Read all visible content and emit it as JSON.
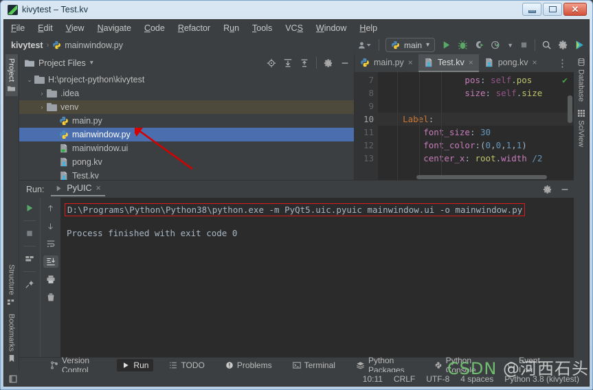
{
  "window": {
    "title": "kivytest – Test.kv",
    "minimize_label": "Minimize",
    "maximize_label": "Restore",
    "close_label": "Close"
  },
  "menubar": [
    {
      "label": "File",
      "mnemonic": "F"
    },
    {
      "label": "Edit",
      "mnemonic": "E"
    },
    {
      "label": "View",
      "mnemonic": "V"
    },
    {
      "label": "Navigate",
      "mnemonic": "N"
    },
    {
      "label": "Code",
      "mnemonic": "C"
    },
    {
      "label": "Refactor",
      "mnemonic": "R"
    },
    {
      "label": "Run",
      "mnemonic": "u"
    },
    {
      "label": "Tools",
      "mnemonic": "T"
    },
    {
      "label": "VCS",
      "mnemonic": "S"
    },
    {
      "label": "Window",
      "mnemonic": "W"
    },
    {
      "label": "Help",
      "mnemonic": "H"
    }
  ],
  "navbar": {
    "breadcrumb_project": "kivytest",
    "breadcrumb_separator": "›",
    "breadcrumb_file": "mainwindow.py",
    "run_config": "main",
    "run_config_dropdown": "▾",
    "icons": [
      "account-dropdown-icon",
      "run-icon",
      "debug-icon",
      "coverage-icon",
      "profile-icon",
      "stop-icon",
      "search-everywhere-icon",
      "settings-icon",
      "ide-help-icon"
    ]
  },
  "left_stripe": [
    {
      "label": "Project",
      "active": true,
      "icon": "folder-icon"
    },
    {
      "label": "Structure",
      "active": false,
      "icon": "structure-icon"
    },
    {
      "label": "Bookmarks",
      "active": false,
      "icon": "bookmark-icon"
    }
  ],
  "right_stripe": [
    {
      "label": "Database",
      "active": false,
      "icon": "database-icon"
    },
    {
      "label": "SciView",
      "active": false,
      "icon": "grid-icon"
    }
  ],
  "project_panel": {
    "title": "Project Files",
    "dropdown": "▾",
    "toolbar_icons": [
      "locate-file-icon",
      "expand-all-icon",
      "collapse-all-icon",
      "settings-icon",
      "hide-panel-icon"
    ],
    "tree": [
      {
        "label": "H:\\project-python\\kivytest",
        "depth": 0,
        "arrow": "⌄",
        "type": "folder",
        "state": "normal"
      },
      {
        "label": ".idea",
        "depth": 1,
        "arrow": "›",
        "type": "folder",
        "state": "normal"
      },
      {
        "label": "venv",
        "depth": 1,
        "arrow": "›",
        "type": "folder",
        "state": "highlight"
      },
      {
        "label": "main.py",
        "depth": 2,
        "arrow": "",
        "type": "python",
        "state": "normal"
      },
      {
        "label": "mainwindow.py",
        "depth": 2,
        "arrow": "",
        "type": "python",
        "state": "selected"
      },
      {
        "label": "mainwindow.ui",
        "depth": 2,
        "arrow": "",
        "type": "qt",
        "state": "normal"
      },
      {
        "label": "pong.kv",
        "depth": 2,
        "arrow": "",
        "type": "kv",
        "state": "normal"
      },
      {
        "label": "Test.kv",
        "depth": 2,
        "arrow": "",
        "type": "kv",
        "state": "normal"
      }
    ]
  },
  "editor": {
    "tabs": [
      {
        "label": "main.py",
        "type": "python",
        "active": false,
        "close": "×"
      },
      {
        "label": "Test.kv",
        "type": "kv",
        "active": true,
        "close": "×"
      },
      {
        "label": "pong.kv",
        "type": "kv",
        "active": false,
        "close": "×"
      }
    ],
    "tabs_overflow_icon": "more-options-icon",
    "inspection_status": "✔",
    "lines": [
      {
        "number": "7",
        "current": false,
        "tokens": [
          {
            "t": "                ",
            "c": "k-white"
          },
          {
            "t": "pos",
            "c": "k-attr"
          },
          {
            "t": ":",
            "c": "k-op"
          },
          {
            "t": " self",
            "c": "k-self"
          },
          {
            "t": ".",
            "c": "k-op"
          },
          {
            "t": "pos",
            "c": "k-fn"
          }
        ]
      },
      {
        "number": "8",
        "current": false,
        "tokens": [
          {
            "t": "                ",
            "c": "k-white"
          },
          {
            "t": "size",
            "c": "k-attr"
          },
          {
            "t": ":",
            "c": "k-op"
          },
          {
            "t": " self",
            "c": "k-self"
          },
          {
            "t": ".",
            "c": "k-op"
          },
          {
            "t": "size",
            "c": "k-fn"
          }
        ]
      },
      {
        "number": "9",
        "current": false,
        "tokens": [
          {
            "t": "",
            "c": "k-white"
          }
        ]
      },
      {
        "number": "10",
        "current": true,
        "tokens": [
          {
            "t": "    ",
            "c": "k-white"
          },
          {
            "t": "Label",
            "c": "k-prop"
          },
          {
            "t": ":",
            "c": "k-op"
          }
        ]
      },
      {
        "number": "11",
        "current": false,
        "tokens": [
          {
            "t": "        ",
            "c": "k-white"
          },
          {
            "t": "font_size",
            "c": "k-attr"
          },
          {
            "t": ": ",
            "c": "k-op"
          },
          {
            "t": "30",
            "c": "k-num"
          }
        ]
      },
      {
        "number": "12",
        "current": false,
        "tokens": [
          {
            "t": "        ",
            "c": "k-white"
          },
          {
            "t": "font_color",
            "c": "k-attr"
          },
          {
            "t": ":(",
            "c": "k-op"
          },
          {
            "t": "0",
            "c": "k-num"
          },
          {
            "t": ",",
            "c": "k-op"
          },
          {
            "t": "0",
            "c": "k-num"
          },
          {
            "t": ",",
            "c": "k-op"
          },
          {
            "t": "1",
            "c": "k-num"
          },
          {
            "t": ",",
            "c": "k-op"
          },
          {
            "t": "1",
            "c": "k-num"
          },
          {
            "t": ")",
            "c": "k-op"
          }
        ]
      },
      {
        "number": "13",
        "current": false,
        "tokens": [
          {
            "t": "        ",
            "c": "k-white"
          },
          {
            "t": "center_x",
            "c": "k-attr"
          },
          {
            "t": ": ",
            "c": "k-op"
          },
          {
            "t": "root",
            "c": "k-fn"
          },
          {
            "t": ".",
            "c": "k-op"
          },
          {
            "t": "width",
            "c": "k-attr"
          },
          {
            "t": " ",
            "c": "k-white"
          },
          {
            "t": "/",
            "c": "k-num"
          },
          {
            "t": "2",
            "c": "k-num"
          }
        ]
      }
    ]
  },
  "run_panel": {
    "label": "Run:",
    "tab_label": "PyUIC",
    "tab_close": "×",
    "tab_icon": "run-small-icon",
    "header_icons": [
      "settings-icon",
      "hide-panel-icon"
    ],
    "left_tools": [
      "rerun-icon",
      "stop-icon",
      "layout-icon",
      "pin-tab-icon"
    ],
    "right_tools": [
      "up-arrow-icon",
      "down-arrow-icon",
      "soft-wrap-icon",
      "scroll-to-end-icon",
      "print-icon",
      "clear-all-icon"
    ],
    "command_line": "D:\\Programs\\Python\\Python38\\python.exe -m PyQt5.uic.pyuic mainwindow.ui -o mainwindow.py",
    "command_border_color": "#e01b1b",
    "output": "Process finished with exit code 0"
  },
  "toolstrip": [
    {
      "label": "Version Control",
      "icon": "branch-icon",
      "active": false
    },
    {
      "label": "Run",
      "icon": "run-icon",
      "active": true
    },
    {
      "label": "TODO",
      "icon": "todo-icon",
      "active": false
    },
    {
      "label": "Problems",
      "icon": "problems-icon",
      "active": false
    },
    {
      "label": "Terminal",
      "icon": "terminal-icon",
      "active": false
    },
    {
      "label": "Python Packages",
      "icon": "packages-icon",
      "active": false
    },
    {
      "label": "Python Console",
      "icon": "python-console-icon",
      "active": false
    }
  ],
  "toolstrip_right": [
    {
      "label": "Event Log",
      "icon": "event-log-icon",
      "active": false
    }
  ],
  "statusbar": {
    "left_icon": "toggle-toolbars-icon",
    "caret_position": "10:11",
    "line_separator": "CRLF",
    "encoding": "UTF-8",
    "indent": "4 spaces",
    "interpreter": "Python 3.8 (kivytest)"
  },
  "watermark": {
    "text_csdn": "CSDN",
    "text_author": "@河西石头"
  }
}
